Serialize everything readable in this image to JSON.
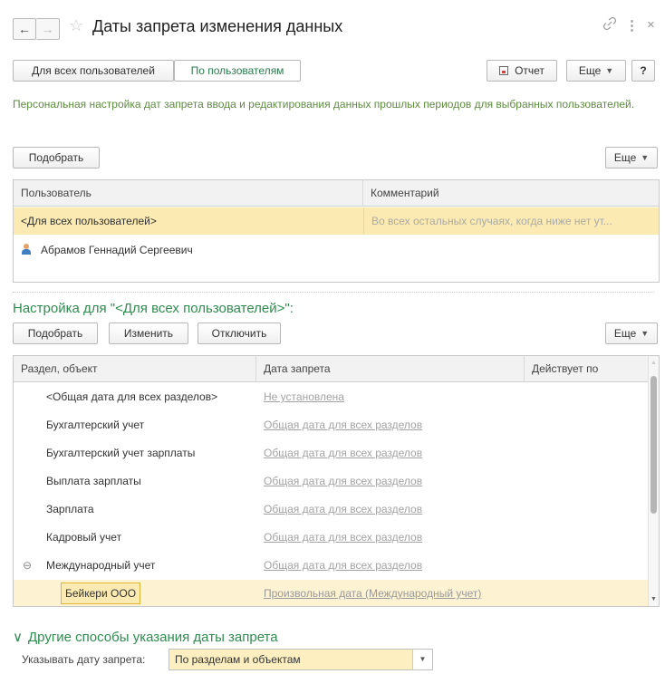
{
  "window": {
    "title": "Даты запрета изменения данных",
    "back_icon": "←",
    "forward_icon": "→",
    "star_icon": "☆",
    "link_icon": "🔗",
    "more_icon": "⋮",
    "close_icon": "×"
  },
  "toolbar": {
    "mode_all": "Для всех пользователей",
    "mode_by_user": "По пользователям",
    "report": "Отчет",
    "more": "Еще",
    "help": "?"
  },
  "description": "Персональная настройка дат запрета ввода и редактирования данных прошлых периодов для выбранных пользователей.",
  "users_section": {
    "pick": "Подобрать",
    "more": "Еще",
    "columns": [
      "Пользователь",
      "Комментарий"
    ],
    "rows": [
      {
        "user": "<Для всех пользователей>",
        "comment": "Во всех остальных случаях, когда ниже нет ут..."
      },
      {
        "user": "Абрамов Геннадий Сергеевич",
        "comment": ""
      }
    ]
  },
  "settings_section": {
    "title": "Настройка для \"<Для всех пользователей>\":",
    "pick": "Подобрать",
    "change": "Изменить",
    "disable": "Отключить",
    "more": "Еще",
    "columns": [
      "Раздел, объект",
      "Дата запрета",
      "Действует по"
    ],
    "rows": [
      {
        "section": "<Общая дата для всех разделов>",
        "date": "Не установлена",
        "valid": ""
      },
      {
        "section": "Бухгалтерский учет",
        "date": "Общая дата для всех разделов",
        "valid": ""
      },
      {
        "section": "Бухгалтерский учет зарплаты",
        "date": "Общая дата для всех разделов",
        "valid": ""
      },
      {
        "section": "Выплата зарплаты",
        "date": "Общая дата для всех разделов",
        "valid": ""
      },
      {
        "section": "Зарплата",
        "date": "Общая дата для всех разделов",
        "valid": ""
      },
      {
        "section": "Кадровый учет",
        "date": "Общая дата для всех разделов",
        "valid": ""
      },
      {
        "section": "Международный учет",
        "date": "Общая дата для всех разделов",
        "valid": "",
        "expander": "⊖"
      },
      {
        "section": "Бейкери ООО",
        "date": "Произвольная дата (Международный учет)",
        "valid": ""
      }
    ]
  },
  "other_methods": {
    "title": "Другие способы указания даты запрета",
    "chevron": "∨",
    "field_label": "Указывать дату запрета:",
    "field_value": "По разделам и объектам"
  }
}
